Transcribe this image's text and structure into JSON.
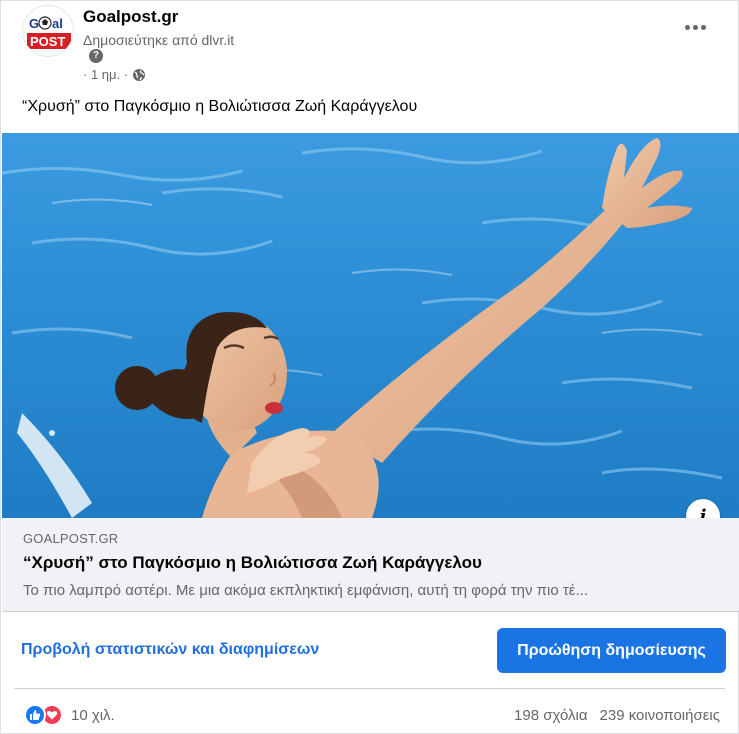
{
  "page": {
    "name": "Goalpost.gr",
    "posted_by": "Δημοσιεύτηκε από dlvr.it",
    "help_glyph": "?",
    "time": "· 1 ημ. ·",
    "avatar_logo": {
      "line1": "Goal",
      "line2": "POST"
    }
  },
  "post": {
    "text": "“Χρυσή” στο Παγκόσμιο η Βολιώτισσα Ζωή Καράγγελου"
  },
  "link": {
    "domain": "GOALPOST.GR",
    "title": "“Χρυσή” στο Παγκόσμιο η Βολιώτισσα Ζωή Καράγγελου",
    "description": "Το πιο λαμπρό αστέρι. Με μια ακόμα εκπληκτική εμφάνιση, αυτή τη φορά την πιο τέ..."
  },
  "actions": {
    "insights_label": "Προβολή στατιστικών και διαφημίσεων",
    "boost_label": "Προώθηση δημοσίευσης"
  },
  "footer": {
    "reaction_count": "10 χιλ.",
    "comments": "198 σχόλια",
    "shares": "239 κοινοποιήσεις"
  },
  "icons": [
    "globe-icon",
    "more-options-icon",
    "help-icon",
    "info-icon",
    "like-icon",
    "love-icon"
  ],
  "colors": {
    "accent": "#1b74e4",
    "link_blue": "#216fdb",
    "muted_text": "#65676b",
    "like": "#1877f2",
    "love": "#f33e58"
  }
}
